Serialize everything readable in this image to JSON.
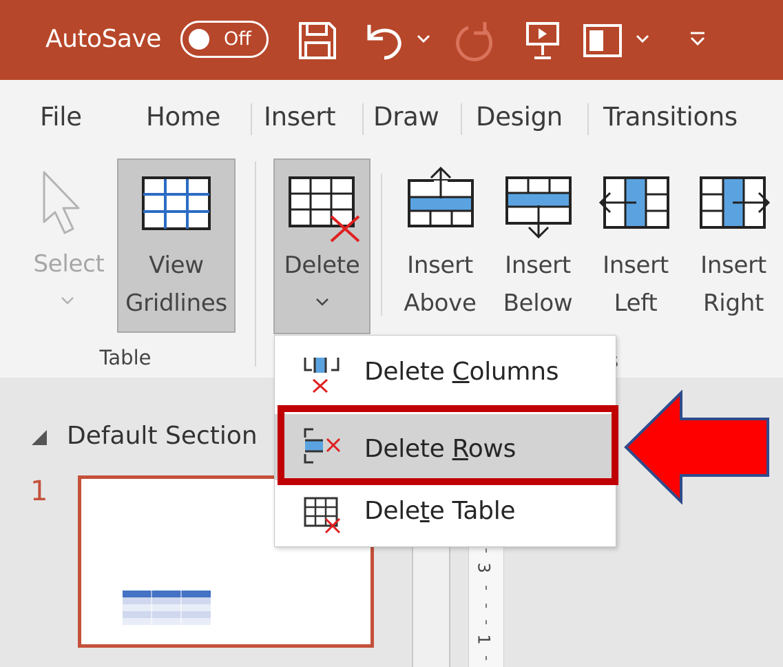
{
  "titlebar": {
    "autosave_label": "AutoSave",
    "toggle_state": "Off",
    "background": "#b7472a"
  },
  "tabs": [
    "File",
    "Home",
    "Insert",
    "Draw",
    "Design",
    "Transitions"
  ],
  "ribbon": {
    "select": {
      "label_line1": "Select",
      "enabled": false
    },
    "view_gridlines": {
      "label_line1": "View",
      "label_line2": "Gridlines",
      "pressed": true
    },
    "table_group_label": "Table",
    "delete": {
      "label": "Delete",
      "pressed": true
    },
    "insert_above": {
      "label_line1": "Insert",
      "label_line2": "Above"
    },
    "insert_below": {
      "label_line1": "Insert",
      "label_line2": "Below"
    },
    "insert_left": {
      "label_line1": "Insert",
      "label_line2": "Left"
    },
    "insert_right": {
      "label_line1": "Insert",
      "label_line2": "Right"
    },
    "partial_group_label": "s"
  },
  "delete_menu": {
    "items": [
      {
        "before": "Delete ",
        "accel": "C",
        "after": "olumns",
        "icon": "delete-columns-icon"
      },
      {
        "before": "Delete ",
        "accel": "R",
        "after": "ows",
        "icon": "delete-rows-icon",
        "highlighted": true
      },
      {
        "before": "Dele",
        "accel": "t",
        "after": "e Table",
        "icon": "delete-table-icon"
      }
    ]
  },
  "slides_pane": {
    "section_title": "Default Section",
    "slide_number": "1"
  },
  "ruler": {
    "labels": [
      "3",
      "1"
    ]
  },
  "annotation": {
    "highlight_color": "#c00000",
    "arrow_color": "#ff0000",
    "arrow_outline": "#2f4b8c"
  }
}
